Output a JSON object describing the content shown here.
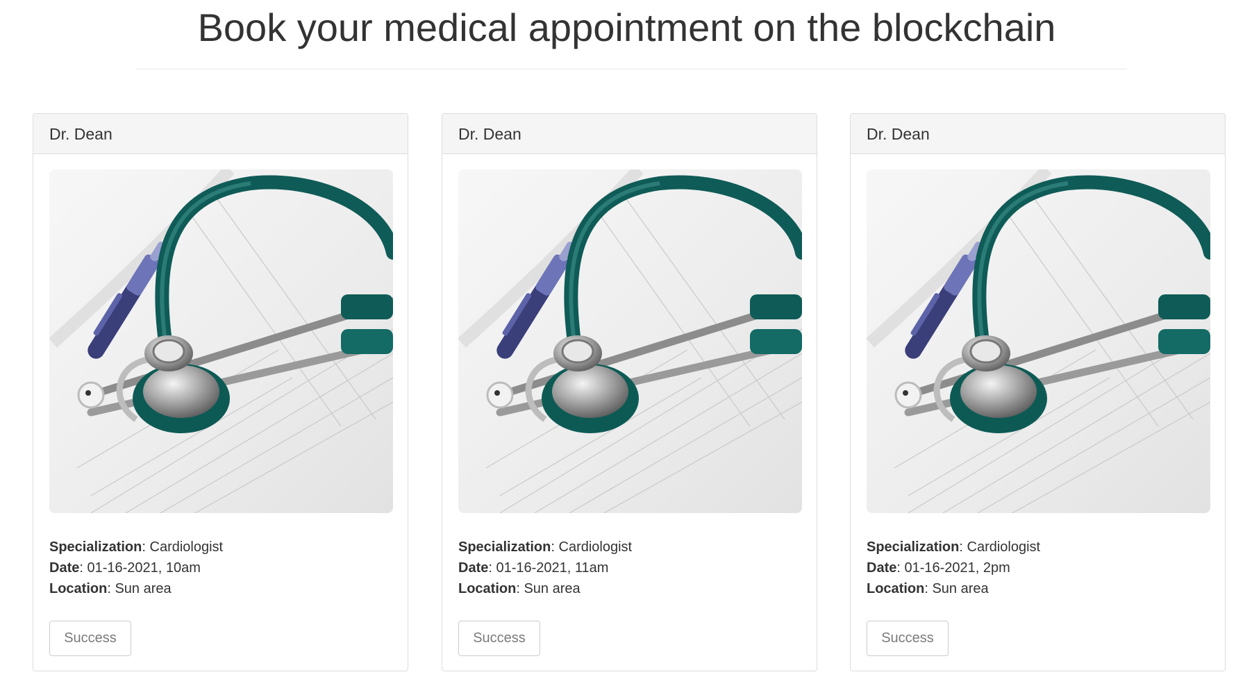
{
  "page": {
    "title": "Book your medical appointment on the blockchain"
  },
  "labels": {
    "specialization": "Specialization",
    "date": "Date",
    "location": "Location"
  },
  "appointments": [
    {
      "doctor": "Dr. Dean",
      "image_icon": "stethoscope-photo",
      "specialization": "Cardiologist",
      "date": "01-16-2021, 10am",
      "location": "Sun area",
      "button_label": "Success"
    },
    {
      "doctor": "Dr. Dean",
      "image_icon": "stethoscope-photo",
      "specialization": "Cardiologist",
      "date": "01-16-2021, 11am",
      "location": "Sun area",
      "button_label": "Success"
    },
    {
      "doctor": "Dr. Dean",
      "image_icon": "stethoscope-photo",
      "specialization": "Cardiologist",
      "date": "01-16-2021, 2pm",
      "location": "Sun area",
      "button_label": "Success"
    }
  ]
}
